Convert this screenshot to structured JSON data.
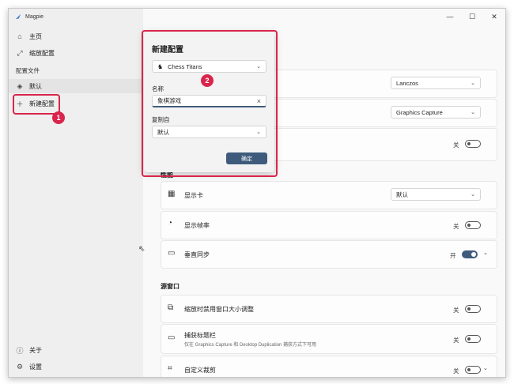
{
  "app": {
    "title": "Magpie"
  },
  "window_controls": {
    "minimize": "—",
    "maximize": "☐",
    "close": "✕"
  },
  "sidebar": {
    "home": "主页",
    "scaling_configs": "缩放配置",
    "section_profiles": "配置文件",
    "default_profile": "默认",
    "new_profile": "新建配置",
    "about": "关于",
    "settings": "设置"
  },
  "badges": {
    "one": "1",
    "two": "2"
  },
  "main": {
    "rows": {
      "scaling_mode": {
        "value": "Lanczos"
      },
      "capture_method": {
        "value": "Graphics Capture"
      },
      "row3_toggle": "关"
    },
    "group_performance": "性能",
    "graphics_card": {
      "label": "显示卡",
      "value": "默认"
    },
    "show_fps": {
      "label": "显示帧率",
      "toggle": "关"
    },
    "vsync": {
      "label": "垂直同步",
      "toggle": "开"
    },
    "group_source_window": "源窗口",
    "disable_resize": {
      "label": "缩放时禁用窗口大小调整",
      "toggle": "关"
    },
    "capture_titlebar": {
      "label": "捕获标题栏",
      "sub": "仅在 Graphics Capture 和 Desktop Duplication 捕获方式下可用",
      "toggle": "关"
    },
    "custom_crop": {
      "label": "自定义裁剪",
      "toggle": "关"
    }
  },
  "dialog": {
    "title": "新建配置",
    "app_select": "Chess Titans",
    "name_label": "名称",
    "name_value": "象棋游戏",
    "copy_from_label": "复制自",
    "copy_from_value": "默认",
    "confirm": "确定"
  }
}
